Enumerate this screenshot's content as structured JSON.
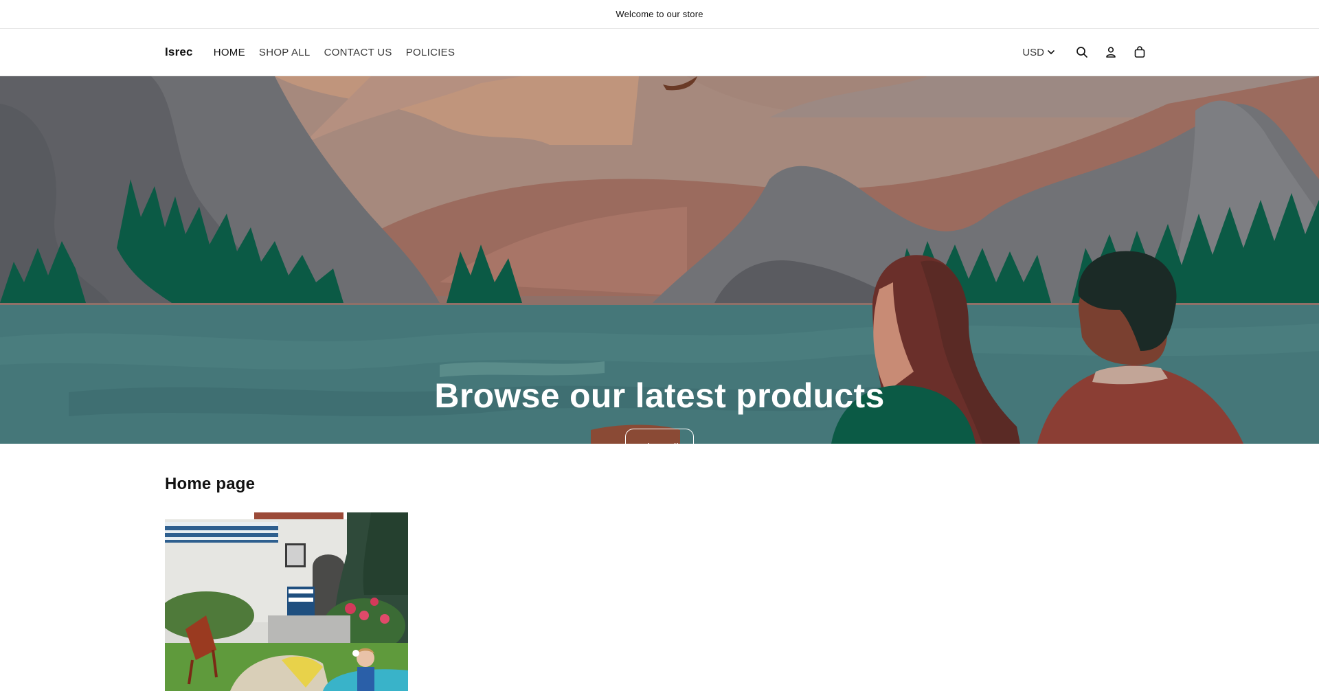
{
  "announcement": {
    "text": "Welcome to our store"
  },
  "header": {
    "logo": "Isrec",
    "nav": [
      {
        "label": "HOME"
      },
      {
        "label": "SHOP ALL"
      },
      {
        "label": "CONTACT US"
      },
      {
        "label": "POLICIES"
      }
    ],
    "currency": "USD",
    "icons": [
      "search-icon",
      "account-icon",
      "cart-icon"
    ]
  },
  "hero": {
    "title": "Browse our latest products",
    "button_label": "Shop all"
  },
  "section": {
    "title": "Home page"
  },
  "colors": {
    "sky": "#9a7468",
    "lake": "#457779",
    "tree": "#0b5a45",
    "mountain": "#6d6e72"
  }
}
